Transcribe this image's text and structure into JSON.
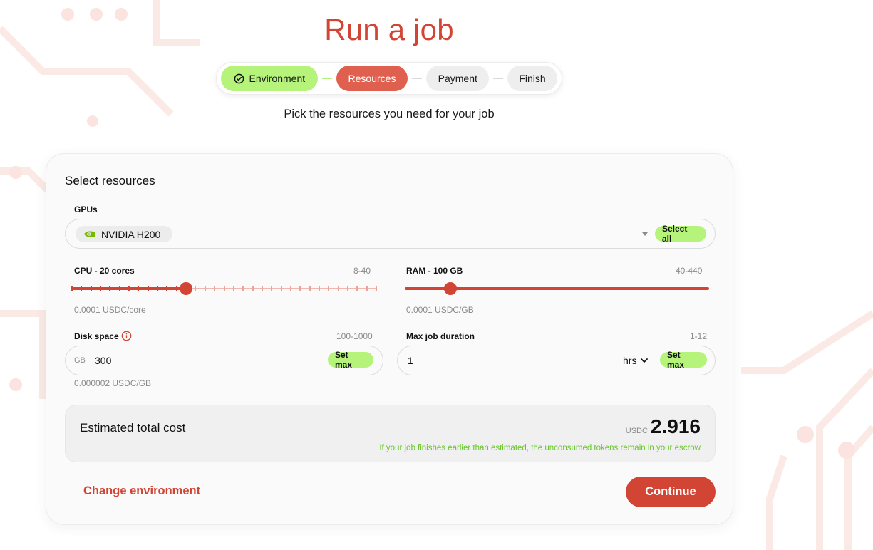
{
  "page": {
    "title": "Run a job",
    "subtitle": "Pick the resources you need for your job"
  },
  "stepper": {
    "steps": [
      {
        "label": "Environment",
        "state": "done",
        "icon": "check-circle-icon"
      },
      {
        "label": "Resources",
        "state": "active"
      },
      {
        "label": "Payment",
        "state": "pending"
      },
      {
        "label": "Finish",
        "state": "pending"
      }
    ]
  },
  "form": {
    "section_title": "Select resources",
    "gpus": {
      "label": "GPUs",
      "selected_chip": "NVIDIA H200",
      "chip_icon": "nvidia-logo-icon",
      "select_all_label": "Select all"
    },
    "cpu": {
      "label": "CPU - 20 cores",
      "range": "8-40",
      "price": "0.0001 USDC/core",
      "min": 8,
      "max": 40,
      "value": 20
    },
    "ram": {
      "label": "RAM - 100 GB",
      "range": "40-440",
      "price": "0.0001 USDC/GB",
      "min": 40,
      "max": 440,
      "value": 100
    },
    "disk": {
      "label": "Disk space",
      "range": "100-1000",
      "unit": "GB",
      "value": "300",
      "set_max_label": "Set max",
      "price": "0.000002 USDC/GB"
    },
    "duration": {
      "label": "Max job duration",
      "range": "1-12",
      "value": "1",
      "unit": "hrs",
      "set_max_label": "Set max"
    }
  },
  "cost": {
    "label": "Estimated total cost",
    "currency": "USDC",
    "value": "2.916",
    "note": "If your job finishes earlier than estimated, the unconsumed tokens remain in your escrow"
  },
  "actions": {
    "back_label": "Change environment",
    "continue_label": "Continue"
  },
  "colors": {
    "accent": "#d24434",
    "success": "#b6f37a",
    "note": "#67c62a"
  }
}
